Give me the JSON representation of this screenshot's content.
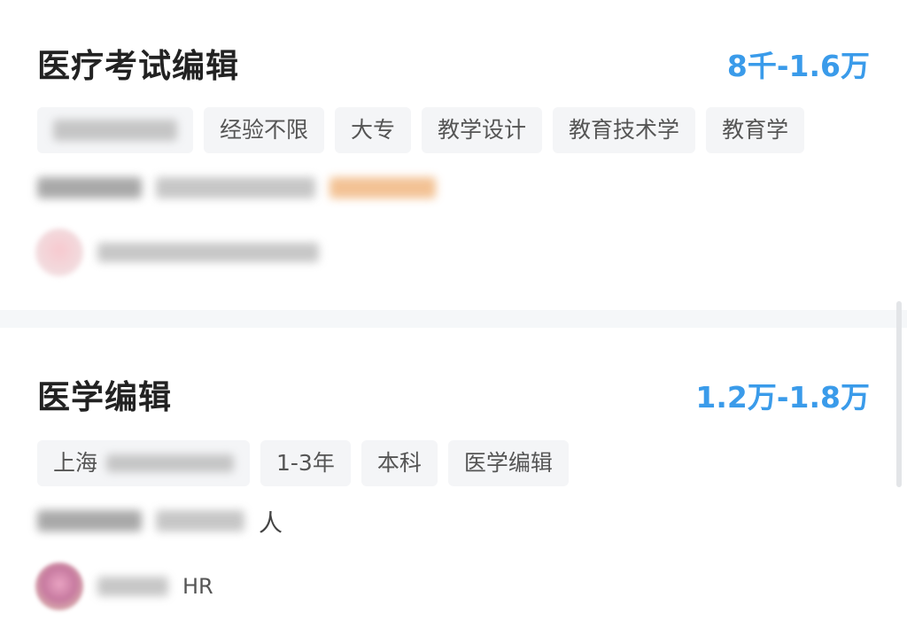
{
  "jobs": [
    {
      "title": "医疗考试编辑",
      "salary": "8千-1.6万",
      "tags": [
        "经验不限",
        "大专",
        "教学设计",
        "教育技术学",
        "教育学"
      ]
    },
    {
      "title": "医学编辑",
      "salary": "1.2万-1.8万",
      "location_prefix": "上海",
      "tags": [
        "1-3年",
        "本科",
        "医学编辑"
      ],
      "company_suffix": "人",
      "recruiter_role": "HR"
    }
  ],
  "colors": {
    "salary": "#3a9bea",
    "tag_background": "#f4f5f7",
    "divider": "#f5f7f9"
  }
}
